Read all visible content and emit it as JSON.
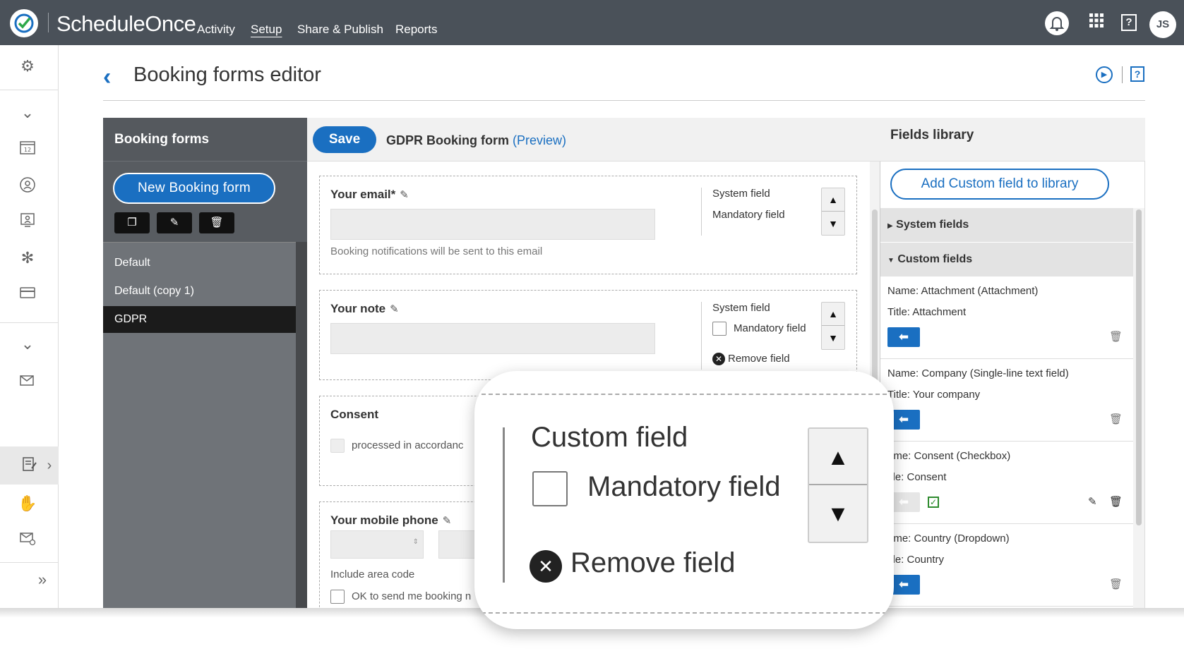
{
  "app": {
    "brand": "ScheduleOnce",
    "user_initials": "JS"
  },
  "nav": [
    {
      "label": "Activity"
    },
    {
      "label": "Setup"
    },
    {
      "label": "Share & Publish"
    },
    {
      "label": "Reports"
    }
  ],
  "header": {
    "title": "Booking forms editor",
    "help": "?"
  },
  "forms_panel": {
    "title": "Booking forms",
    "new_button": "New Booking form",
    "items": [
      {
        "label": "Default"
      },
      {
        "label": "Default (copy 1)"
      },
      {
        "label": "GDPR"
      }
    ],
    "selected": "GDPR"
  },
  "editor": {
    "save_label": "Save",
    "form_name": "GDPR Booking form",
    "preview_label": "(Preview)",
    "fields": [
      {
        "label": "Your email",
        "required_mark": "*",
        "help": "Booking notifications will be sent to this email",
        "type_text": "System field",
        "mandatory_text": "Mandatory field"
      },
      {
        "label": "Your note",
        "type_text": "System field",
        "mandatory_text": "Mandatory field",
        "remove_text": "Remove field"
      },
      {
        "label": "Consent",
        "checkbox_text": "processed in accordanc"
      },
      {
        "label": "Your mobile phone",
        "help": "Include area code",
        "checkbox_text": "OK to send me booking n"
      }
    ]
  },
  "library": {
    "title": "Fields library",
    "add_button": "Add Custom field to library",
    "system_section": "System fields",
    "custom_section": "Custom fields",
    "items": [
      {
        "name": "Name: Attachment (Attachment)",
        "title": "Title: Attachment"
      },
      {
        "name": "Name: Company (Single-line text field)",
        "title": "Title: Your company"
      },
      {
        "name": "ame: Consent (Checkbox)",
        "title": "itle: Consent"
      },
      {
        "name": "ame: Country (Dropdown)",
        "title": "itle: Country"
      }
    ]
  },
  "zoom": {
    "title": "Custom field",
    "mandatory": "Mandatory field",
    "remove": "Remove field"
  },
  "colors": {
    "accent": "#1a6fc1",
    "topbar": "#4a5159",
    "panel_dark": "#585c61"
  }
}
